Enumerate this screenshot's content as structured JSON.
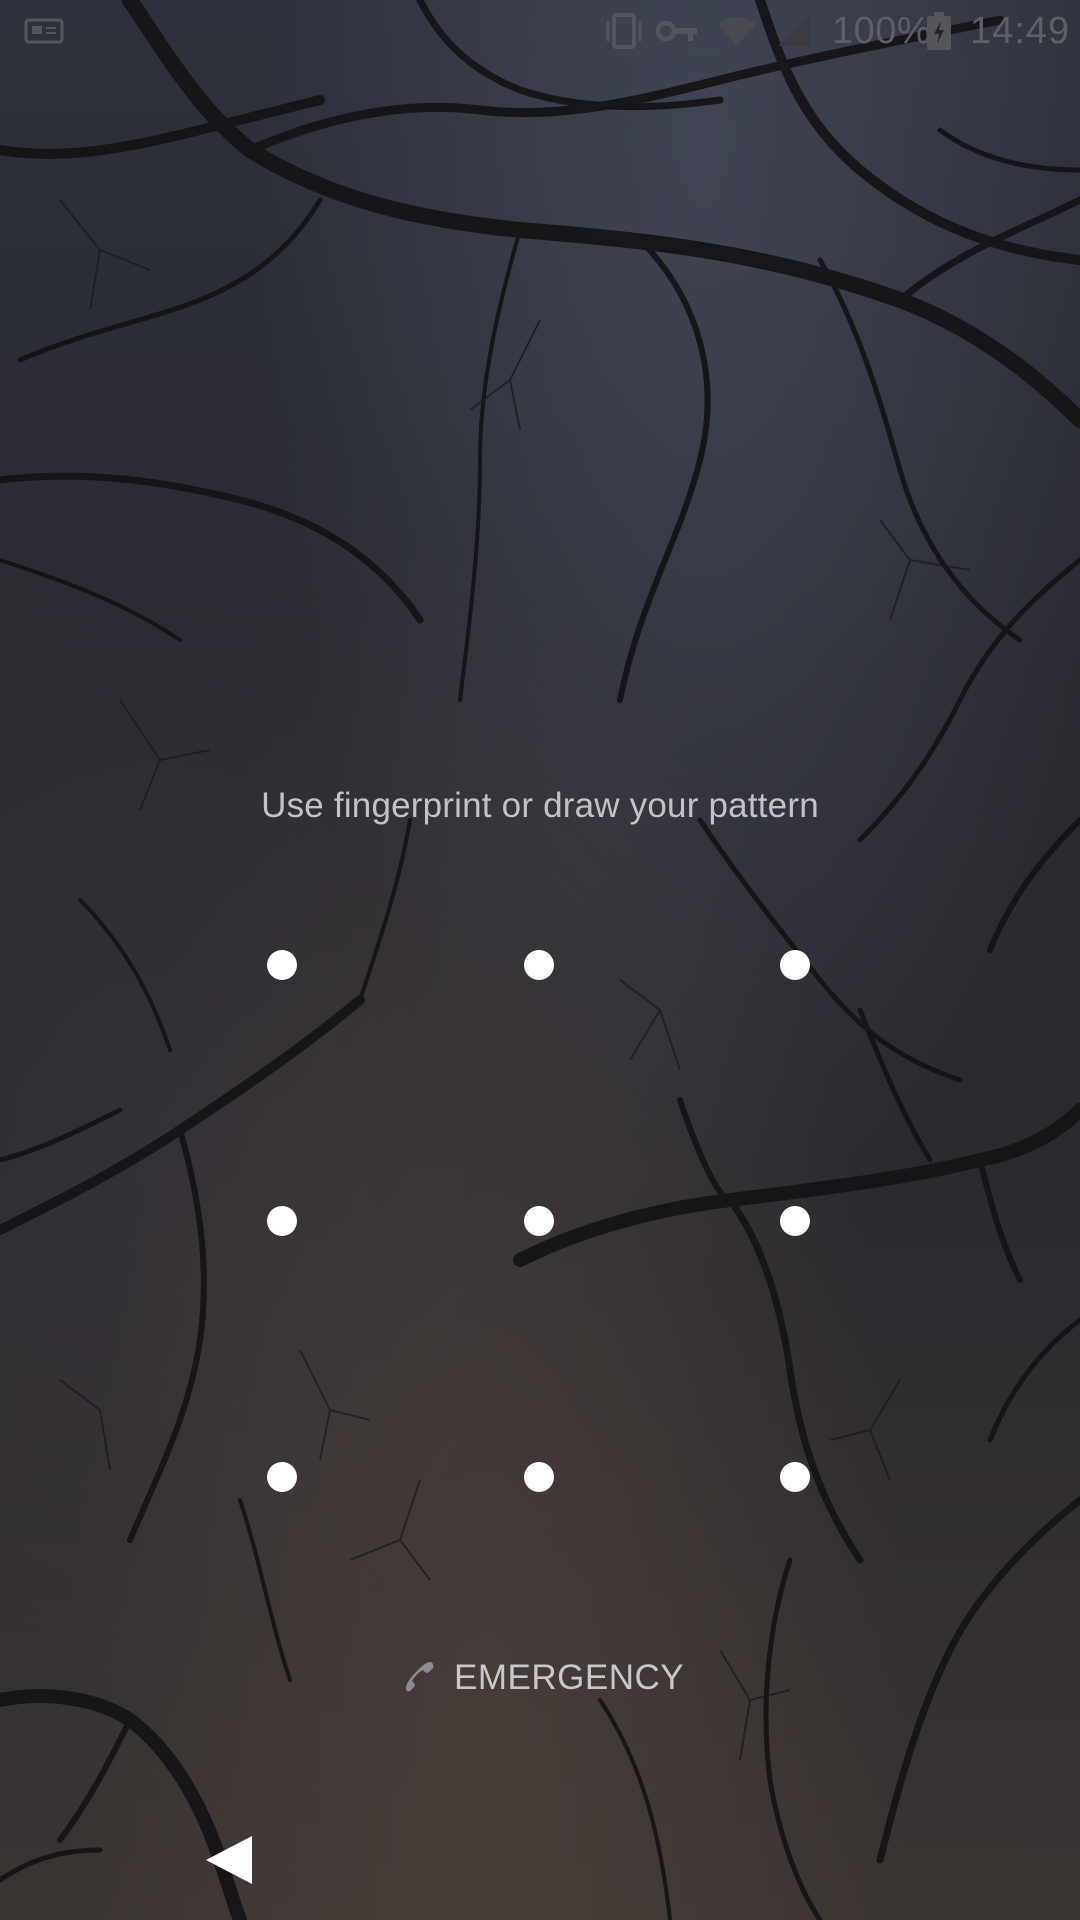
{
  "status_bar": {
    "battery_percent": "100%",
    "time": "14:49",
    "icons": [
      "sim-card-icon",
      "vibrate-icon",
      "vpn-key-icon",
      "wifi-icon",
      "signal-icon",
      "battery-charging-icon"
    ]
  },
  "lock_screen": {
    "prompt": "Use fingerprint or draw your pattern",
    "pattern_dots": [
      {
        "row": 1,
        "col": 1
      },
      {
        "row": 1,
        "col": 2
      },
      {
        "row": 1,
        "col": 3
      },
      {
        "row": 2,
        "col": 1
      },
      {
        "row": 2,
        "col": 2
      },
      {
        "row": 2,
        "col": 3
      },
      {
        "row": 3,
        "col": 1
      },
      {
        "row": 3,
        "col": 2
      },
      {
        "row": 3,
        "col": 3
      }
    ],
    "emergency_label": "EMERGENCY"
  },
  "navigation": {
    "icons": [
      "back-icon"
    ]
  },
  "colors": {
    "dot": "#ffffff",
    "text": "#c4c2c6",
    "status_text": "#5f5f66"
  }
}
